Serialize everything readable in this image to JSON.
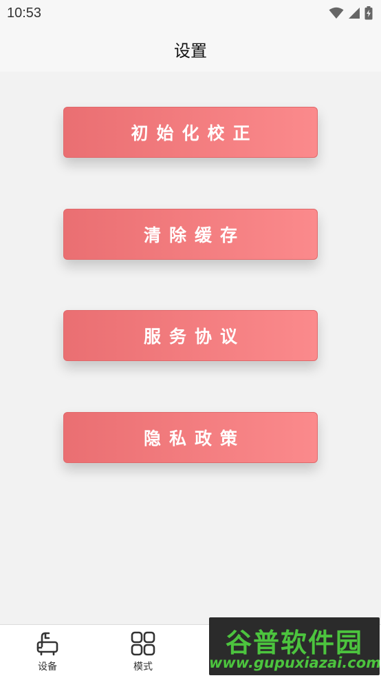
{
  "status_bar": {
    "time": "10:53",
    "icons": [
      "wifi-icon",
      "signal-icon",
      "battery-charging-icon"
    ]
  },
  "header": {
    "title": "设置"
  },
  "actions": [
    {
      "label": "初始化校正"
    },
    {
      "label": "清除缓存"
    },
    {
      "label": "服务协议"
    },
    {
      "label": "隐私政策"
    }
  ],
  "tabs": [
    {
      "label": "设备",
      "icon": "device-icon"
    },
    {
      "label": "模式",
      "icon": "grid-icon"
    }
  ],
  "watermark": {
    "title": "谷普软件园",
    "url": "www.gupuxiazai.com"
  },
  "colors": {
    "button_start": "#ea6f72",
    "button_end": "#fb8a8c",
    "watermark_green": "#4cc43e"
  }
}
